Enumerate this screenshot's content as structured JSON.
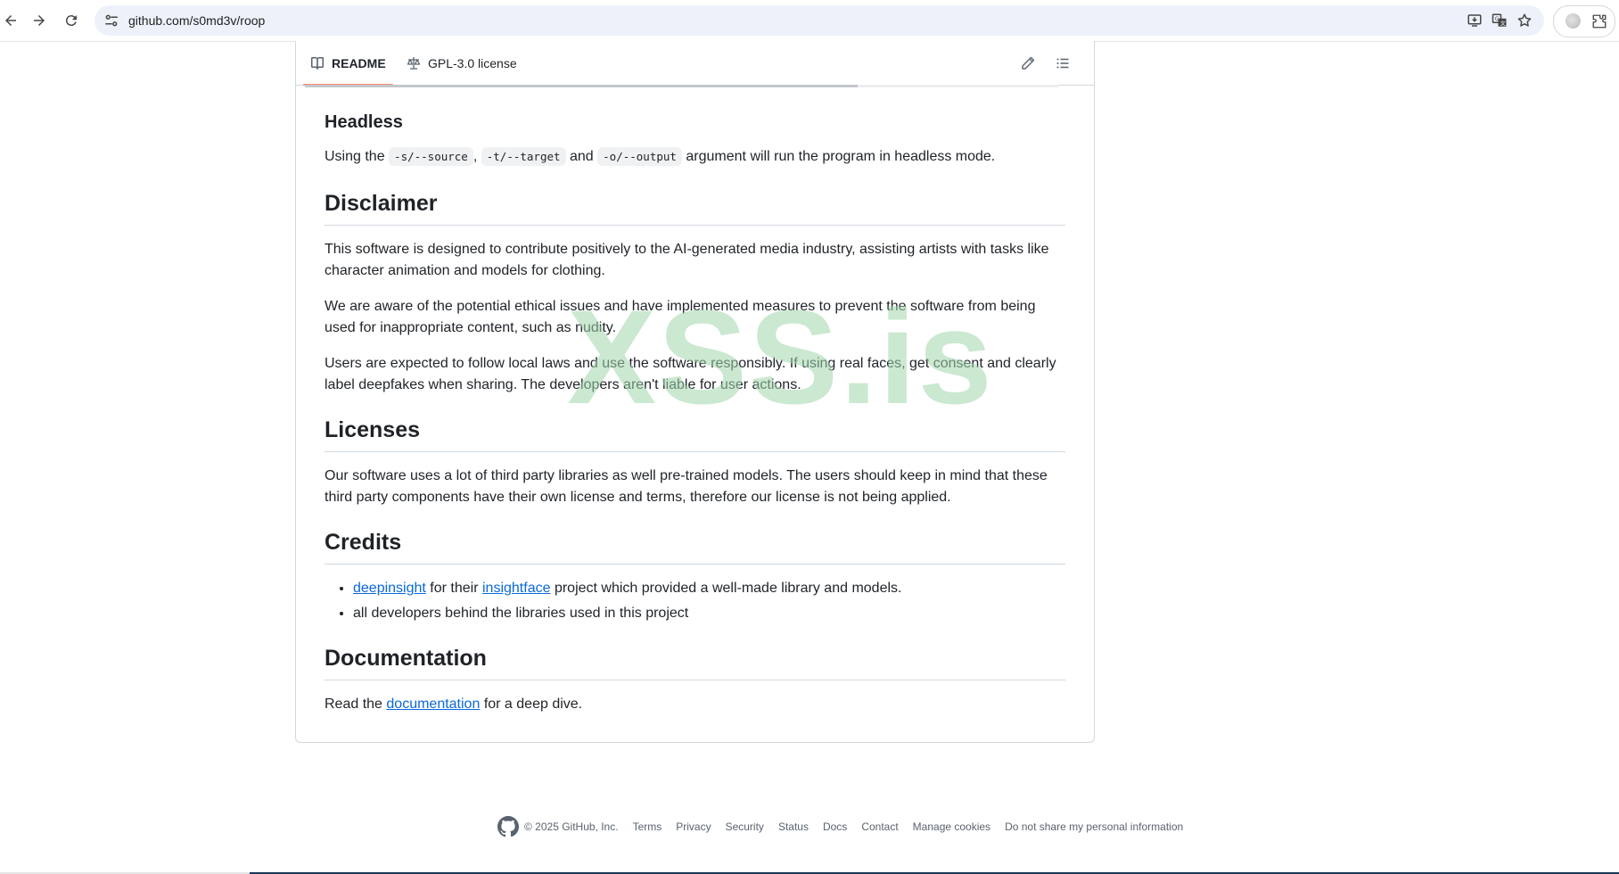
{
  "browser": {
    "url": "github.com/s0md3v/roop"
  },
  "tabs": {
    "readme_label": "README",
    "license_label": "GPL-3.0 license"
  },
  "headless": {
    "title": "Headless",
    "text_prefix": "Using the",
    "code_source": "-s/--source",
    "sep1": ",",
    "code_target": "-t/--target",
    "and": "and",
    "code_output": "-o/--output",
    "text_suffix": "argument will run the program in headless mode."
  },
  "disclaimer": {
    "title": "Disclaimer",
    "p1": "This software is designed to contribute positively to the AI-generated media industry, assisting artists with tasks like character animation and models for clothing.",
    "p2": "We are aware of the potential ethical issues and have implemented measures to prevent the software from being used for inappropriate content, such as nudity.",
    "p3": "Users are expected to follow local laws and use the software responsibly. If using real faces, get consent and clearly label deepfakes when sharing. The developers aren't liable for user actions."
  },
  "licenses": {
    "title": "Licenses",
    "p1": "Our software uses a lot of third party libraries as well pre-trained models. The users should keep in mind that these third party components have their own license and terms, therefore our license is not being applied."
  },
  "credits": {
    "title": "Credits",
    "item1_link1": "deepinsight",
    "item1_mid": "for their",
    "item1_link2": "insightface",
    "item1_suffix": "project which provided a well-made library and models.",
    "item2": "all developers behind the libraries used in this project"
  },
  "documentation": {
    "title": "Documentation",
    "prefix": "Read the",
    "link": "documentation",
    "suffix": "for a deep dive."
  },
  "watermark": "XSS.is",
  "footer": {
    "copyright": "© 2025 GitHub, Inc.",
    "links": [
      "Terms",
      "Privacy",
      "Security",
      "Status",
      "Docs",
      "Contact",
      "Manage cookies",
      "Do not share my personal information"
    ]
  }
}
